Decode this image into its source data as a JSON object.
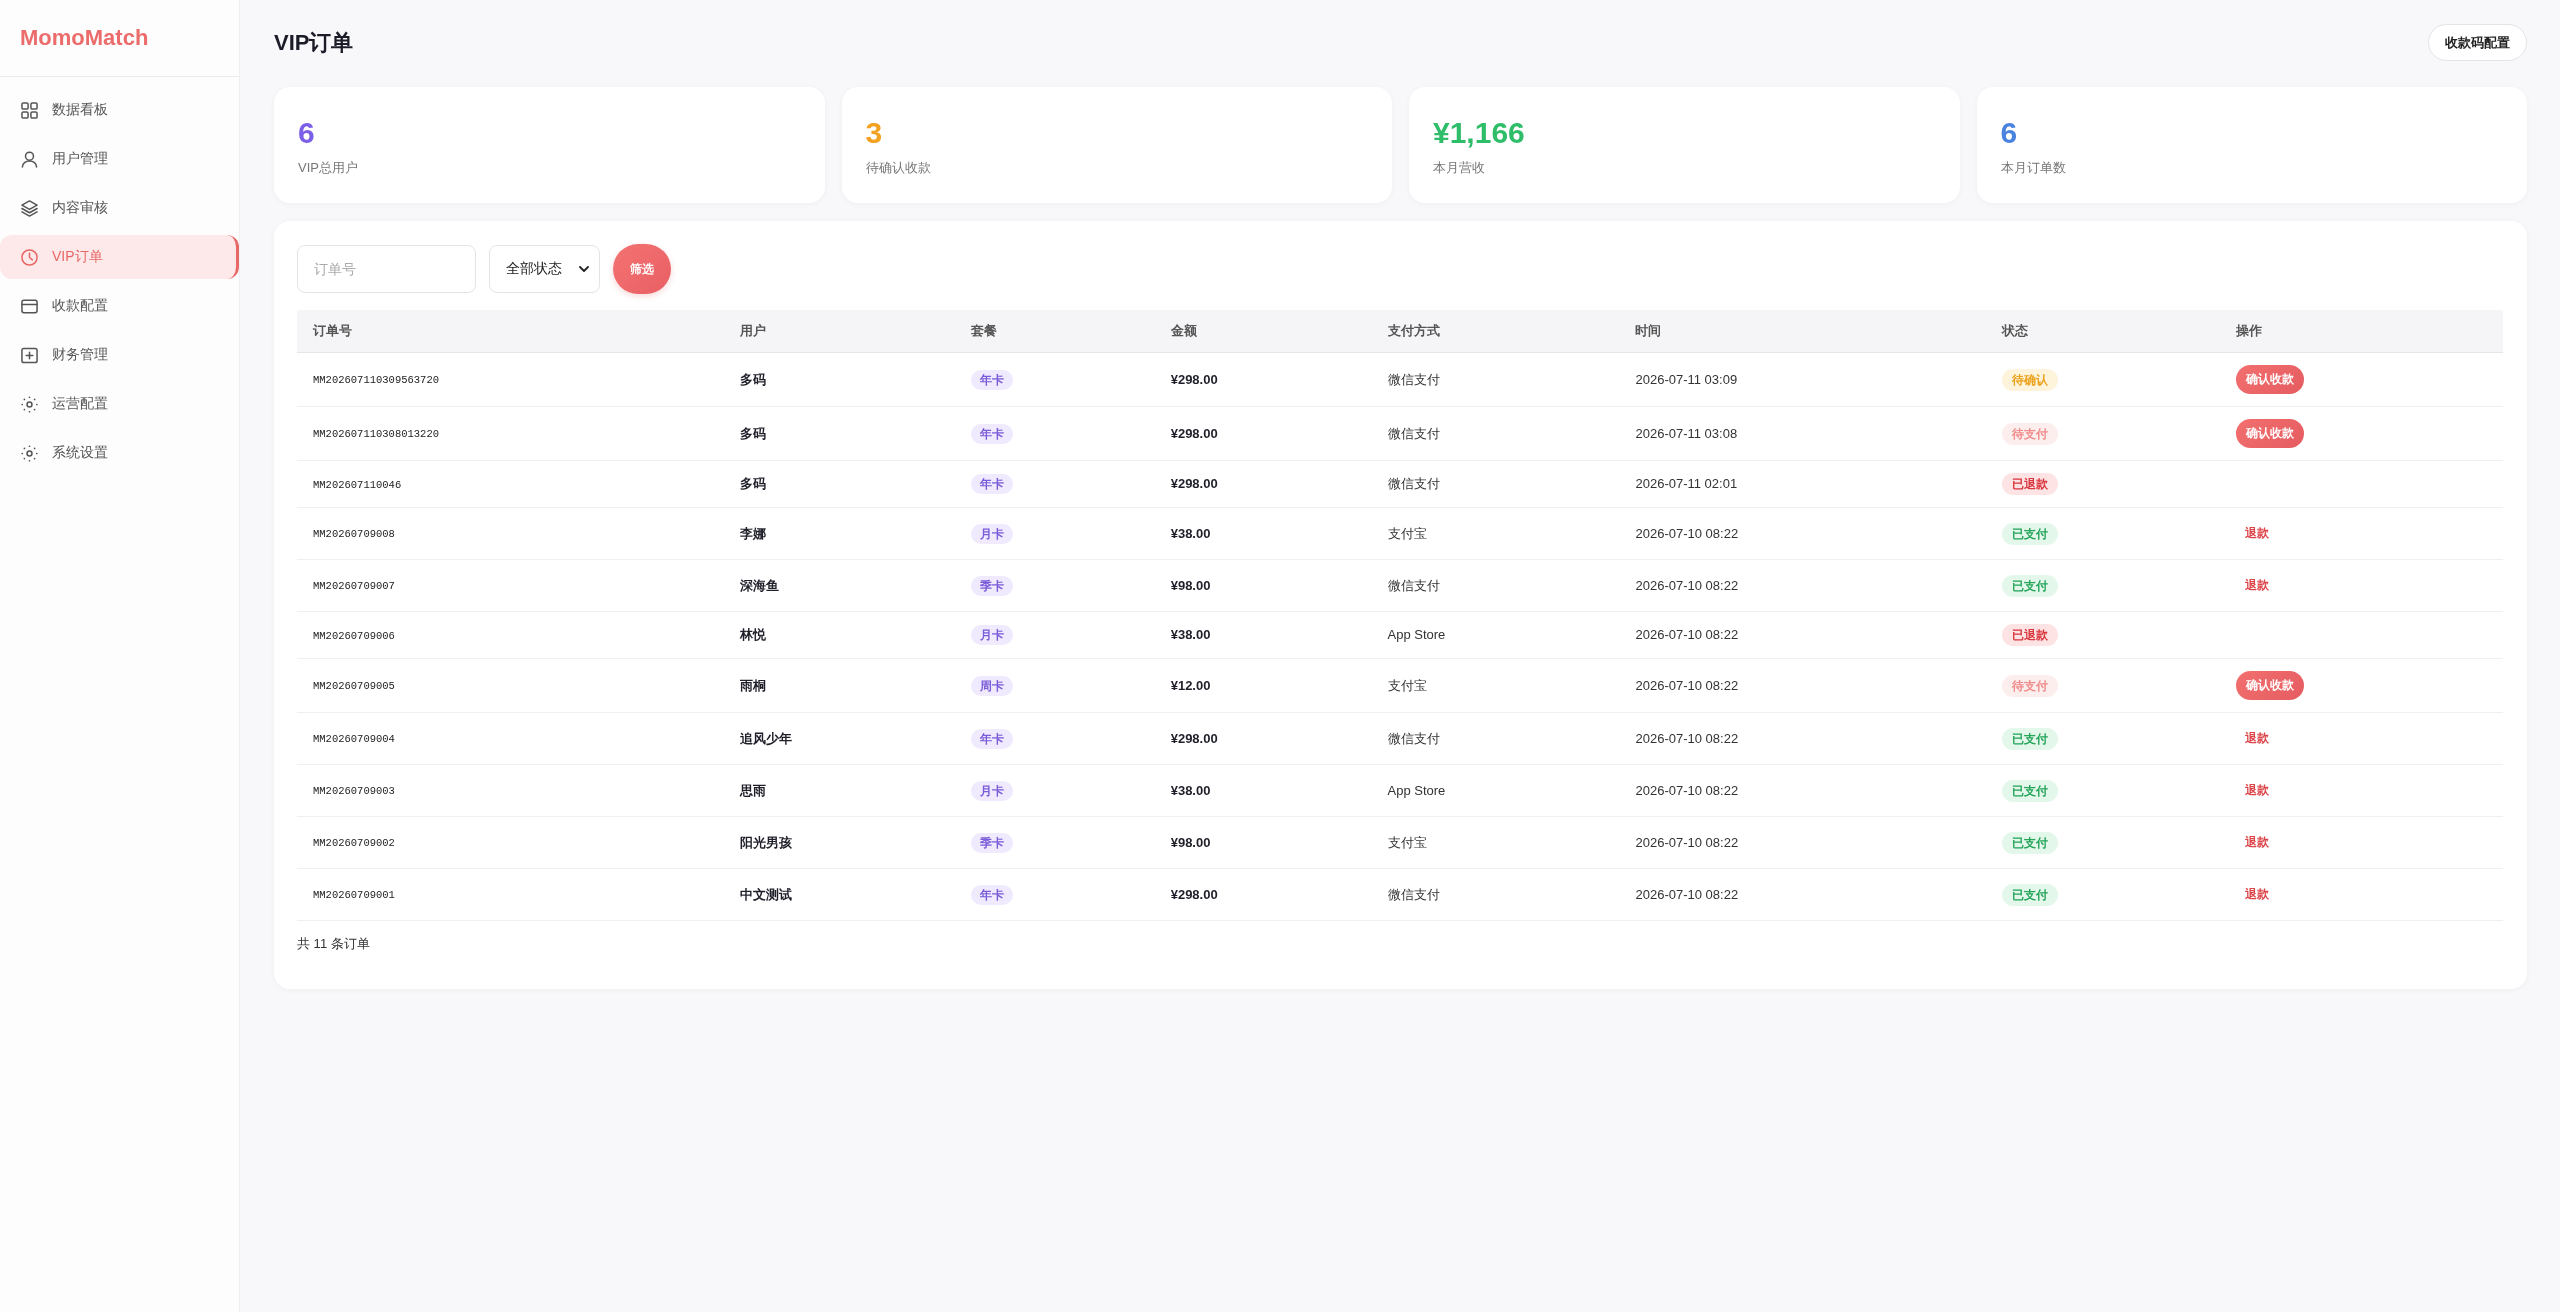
{
  "sidebar": {
    "logo": "MomoMatch",
    "items": [
      {
        "label": "数据看板",
        "selected": false
      },
      {
        "label": "用户管理",
        "selected": false
      },
      {
        "label": "内容审核",
        "selected": false
      },
      {
        "label": "VIP订单",
        "selected": true
      },
      {
        "label": "收款配置",
        "selected": false
      },
      {
        "label": "财务管理",
        "selected": false
      },
      {
        "label": "运营配置",
        "selected": false
      },
      {
        "label": "系统设置",
        "selected": false
      }
    ]
  },
  "header": {
    "title": "VIP订单",
    "button": "收款码配置"
  },
  "stats": [
    {
      "value": "6",
      "label": "VIP总用户",
      "color": "#7b5fe6"
    },
    {
      "value": "3",
      "label": "待确认收款",
      "color": "#f2a120"
    },
    {
      "value": "¥1,166",
      "label": "本月营收",
      "color": "#2ebd68"
    },
    {
      "value": "6",
      "label": "本月订单数",
      "color": "#4a82e0"
    }
  ],
  "filters": {
    "order_field": {
      "placeholder": "订单号"
    },
    "status_select": {
      "value": "全部状态"
    },
    "button": "筛选"
  },
  "table": {
    "columns": [
      "订单号",
      "用户",
      "套餐",
      "金额",
      "支付方式",
      "时间",
      "状态",
      "操作"
    ],
    "rows": [
      {
        "order_no": "MM202607110309563720",
        "user": "多码",
        "plan": "年卡",
        "amount": "¥298.00",
        "payment": "微信支付",
        "time": "2026-07-11 03:09",
        "status": {
          "label": "待确认",
          "kind": "pending"
        },
        "action": {
          "label": "确认收款",
          "kind": "confirm"
        }
      },
      {
        "order_no": "MM202607110308013220",
        "user": "多码",
        "plan": "年卡",
        "amount": "¥298.00",
        "payment": "微信支付",
        "time": "2026-07-11 03:08",
        "status": {
          "label": "待支付",
          "kind": "unpaid"
        },
        "action": {
          "label": "确认收款",
          "kind": "confirm"
        }
      },
      {
        "order_no": "MM202607110046",
        "user": "多码",
        "plan": "年卡",
        "amount": "¥298.00",
        "payment": "微信支付",
        "time": "2026-07-11 02:01",
        "status": {
          "label": "已退款",
          "kind": "refunded"
        }
      },
      {
        "order_no": "MM20260709008",
        "user": "李娜",
        "plan": "月卡",
        "amount": "¥38.00",
        "payment": "支付宝",
        "time": "2026-07-10 08:22",
        "status": {
          "label": "已支付",
          "kind": "paid"
        },
        "action": {
          "label": "退款",
          "kind": "refund"
        }
      },
      {
        "order_no": "MM20260709007",
        "user": "深海鱼",
        "plan": "季卡",
        "amount": "¥98.00",
        "payment": "微信支付",
        "time": "2026-07-10 08:22",
        "status": {
          "label": "已支付",
          "kind": "paid"
        },
        "action": {
          "label": "退款",
          "kind": "refund"
        }
      },
      {
        "order_no": "MM20260709006",
        "user": "林悦",
        "plan": "月卡",
        "amount": "¥38.00",
        "payment": "App Store",
        "time": "2026-07-10 08:22",
        "status": {
          "label": "已退款",
          "kind": "refunded"
        }
      },
      {
        "order_no": "MM20260709005",
        "user": "雨桐",
        "plan": "周卡",
        "amount": "¥12.00",
        "payment": "支付宝",
        "time": "2026-07-10 08:22",
        "status": {
          "label": "待支付",
          "kind": "unpaid"
        },
        "action": {
          "label": "确认收款",
          "kind": "confirm"
        }
      },
      {
        "order_no": "MM20260709004",
        "user": "追风少年",
        "plan": "年卡",
        "amount": "¥298.00",
        "payment": "微信支付",
        "time": "2026-07-10 08:22",
        "status": {
          "label": "已支付",
          "kind": "paid"
        },
        "action": {
          "label": "退款",
          "kind": "refund"
        }
      },
      {
        "order_no": "MM20260709003",
        "user": "思雨",
        "plan": "月卡",
        "amount": "¥38.00",
        "payment": "App Store",
        "time": "2026-07-10 08:22",
        "status": {
          "label": "已支付",
          "kind": "paid"
        },
        "action": {
          "label": "退款",
          "kind": "refund"
        }
      },
      {
        "order_no": "MM20260709002",
        "user": "阳光男孩",
        "plan": "季卡",
        "amount": "¥98.00",
        "payment": "支付宝",
        "time": "2026-07-10 08:22",
        "status": {
          "label": "已支付",
          "kind": "paid"
        },
        "action": {
          "label": "退款",
          "kind": "refund"
        }
      },
      {
        "order_no": "MM20260709001",
        "user": "中文测试",
        "plan": "年卡",
        "amount": "¥298.00",
        "payment": "微信支付",
        "time": "2026-07-10 08:22",
        "status": {
          "label": "已支付",
          "kind": "paid"
        },
        "action": {
          "label": "退款",
          "kind": "refund"
        }
      }
    ]
  },
  "footer": "共 11 条订单"
}
